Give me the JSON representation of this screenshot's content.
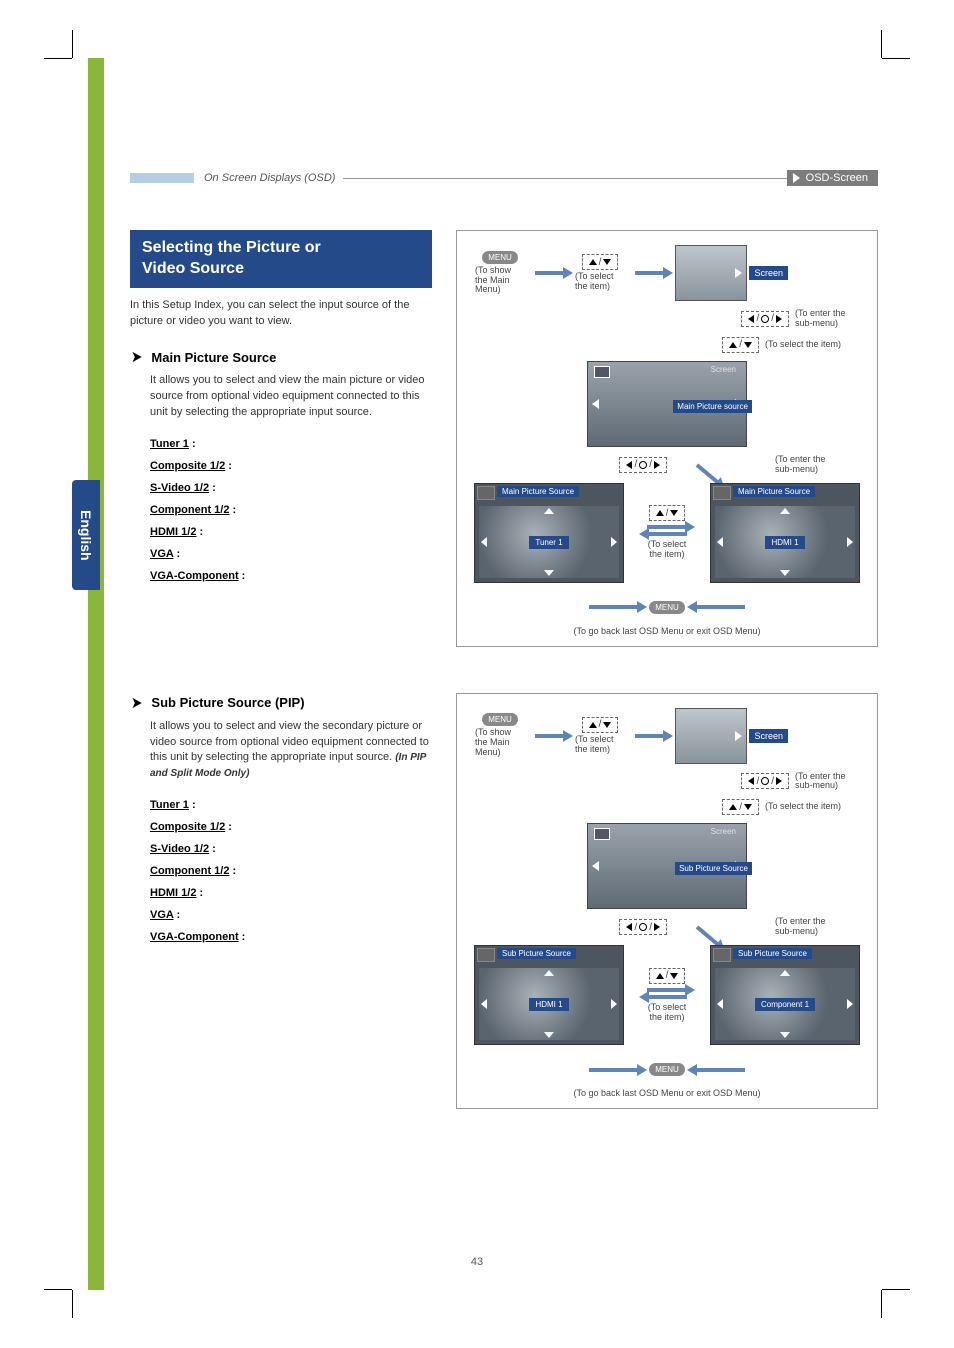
{
  "header": {
    "left_title": "On Screen Displays (OSD)",
    "right_label": "OSD-Screen"
  },
  "side_tab": "English",
  "section1": {
    "box_line1": "Selecting the Picture or",
    "box_line2": "Video Source",
    "intro": "In this Setup Index, you can select the input source of the picture or video you want to view.",
    "head": "Main Picture Source",
    "body": "It allows you to select and view the main picture or video source from optional video equipment connected to this unit by selecting the appropriate input source.",
    "sources": {
      "tuner": "Tuner 1",
      "composite": "Composite 1/2",
      "svideo": "S-Video 1/2",
      "component": "Component 1/2",
      "hdmi": "HDMI 1/2",
      "vga": "VGA",
      "vgacomp": "VGA-Component"
    }
  },
  "section2": {
    "head": "Sub Picture Source (PIP)",
    "body": "It allows you to select and view the secondary picture or video source from optional video equipment connected to this unit by selecting the appropriate input source.",
    "note": "(In PIP and Split Mode Only)",
    "sources": {
      "tuner": "Tuner 1",
      "composite": "Composite 1/2",
      "svideo": "S-Video 1/2",
      "component": "Component 1/2",
      "hdmi": "HDMI 1/2",
      "vga": "VGA",
      "vgacomp": "VGA-Component"
    }
  },
  "diagram": {
    "menu_btn": "MENU",
    "show_main": "(To show the Main Menu)",
    "select_item": "(To select the item)",
    "enter_sub": "(To enter the sub-menu)",
    "select_item2": "(To select the item)",
    "screen_label": "Screen",
    "main_src_callout": "Main Picture source",
    "main_src_hdr": "Main Picture Source",
    "sub_src_callout": "Sub Picture Source",
    "sub_src_hdr": "Sub Picture Source",
    "val_tuner": "Tuner 1",
    "val_hdmi_left": "HDMI 1",
    "val_hdmi_right": "HDMI 1",
    "val_component": "Component 1",
    "go_back": "(To go back last OSD Menu or exit OSD Menu)"
  },
  "page_number": "43",
  "colon": " :"
}
